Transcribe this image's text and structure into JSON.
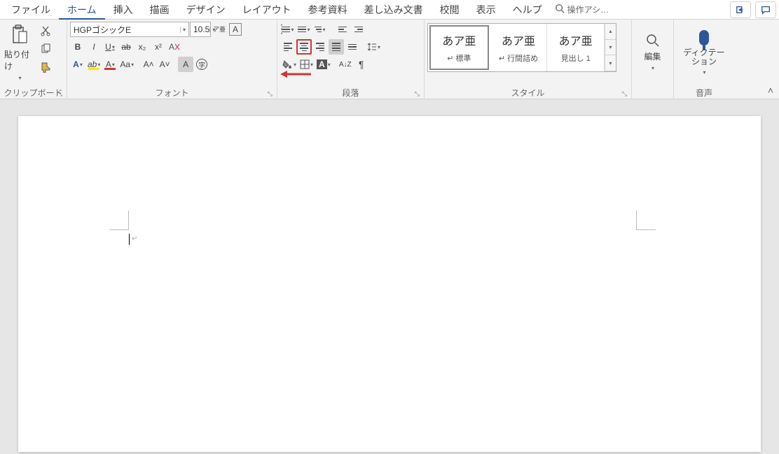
{
  "menu": {
    "tabs": [
      "ファイル",
      "ホーム",
      "挿入",
      "描画",
      "デザイン",
      "レイアウト",
      "参考資料",
      "差し込み文書",
      "校閲",
      "表示",
      "ヘルプ"
    ],
    "active_index": 1,
    "search_placeholder": "操作アシ…"
  },
  "ribbon": {
    "clipboard": {
      "label": "クリップボード",
      "paste": "貼り付け"
    },
    "font": {
      "label": "フォント",
      "name": "HGPゴシックE",
      "size": "10.5",
      "ruby": "ア亜",
      "box": "A",
      "bold": "B",
      "italic": "I",
      "underline": "U",
      "strike": "ab",
      "subscript": "x₂",
      "superscript": "x²",
      "textfx": "A",
      "highlight": "ab",
      "fontcolor": "A",
      "changecase": "Aa",
      "grow": "A˄",
      "shrink": "A˅",
      "charshade": "A",
      "enclosed": "字"
    },
    "paragraph": {
      "label": "段落",
      "sort": "A↓Z"
    },
    "styles": {
      "label": "スタイル",
      "items": [
        {
          "sample": "あア亜",
          "name": "↵ 標準"
        },
        {
          "sample": "あア亜",
          "name": "↵ 行間詰め"
        },
        {
          "sample": "あア亜",
          "name": "見出し 1"
        }
      ]
    },
    "editing": {
      "label": "編集"
    },
    "voice": {
      "button": "ディクテーション",
      "label": "音声"
    }
  }
}
